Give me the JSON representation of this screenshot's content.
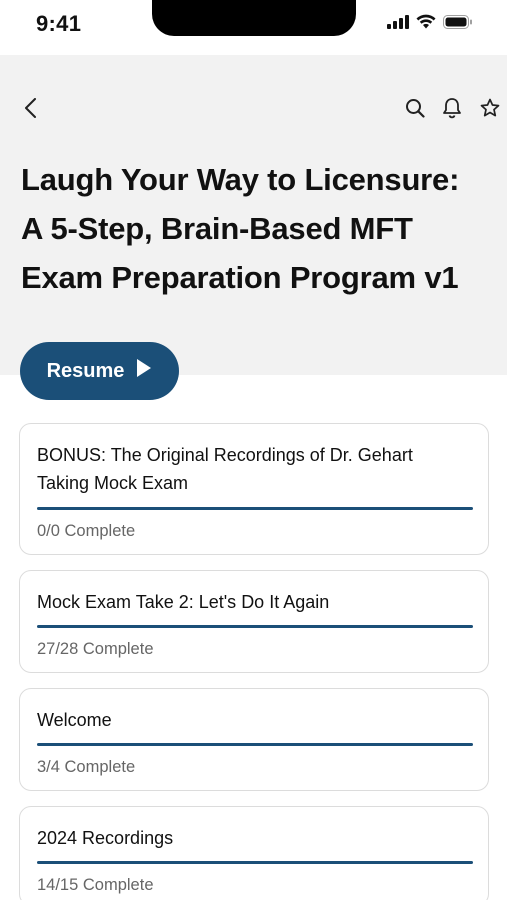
{
  "status_bar": {
    "time": "9:41"
  },
  "header": {
    "back_icon": "chevron-left-icon",
    "actions": [
      "search-icon",
      "bell-icon",
      "star-icon"
    ],
    "title_lines": [
      "Laugh Your Way to Licensure:",
      "A 5-Step, Brain-Based MFT",
      "Exam Preparation Program v1"
    ]
  },
  "resume_button": {
    "label": "Resume",
    "icon": "play-icon"
  },
  "sections": [
    {
      "title_lines": [
        "BONUS: The Original Recordings of Dr. Gehart",
        "Taking Mock Exam"
      ],
      "status": "0/0 Complete",
      "progress": 1.0
    },
    {
      "title_lines": [
        "Mock Exam Take 2: Let's Do It Again"
      ],
      "status": "27/28 Complete",
      "progress": 1.0
    },
    {
      "title_lines": [
        "Welcome"
      ],
      "status": "3/4 Complete",
      "progress": 1.0
    },
    {
      "title_lines": [
        "2024 Recordings"
      ],
      "status": "14/15 Complete",
      "progress": 1.0
    }
  ],
  "colors": {
    "accent": "#1b4f78",
    "header_bg": "#f2f2f2",
    "card_border": "#dcdcdc",
    "status_text": "#666666"
  }
}
